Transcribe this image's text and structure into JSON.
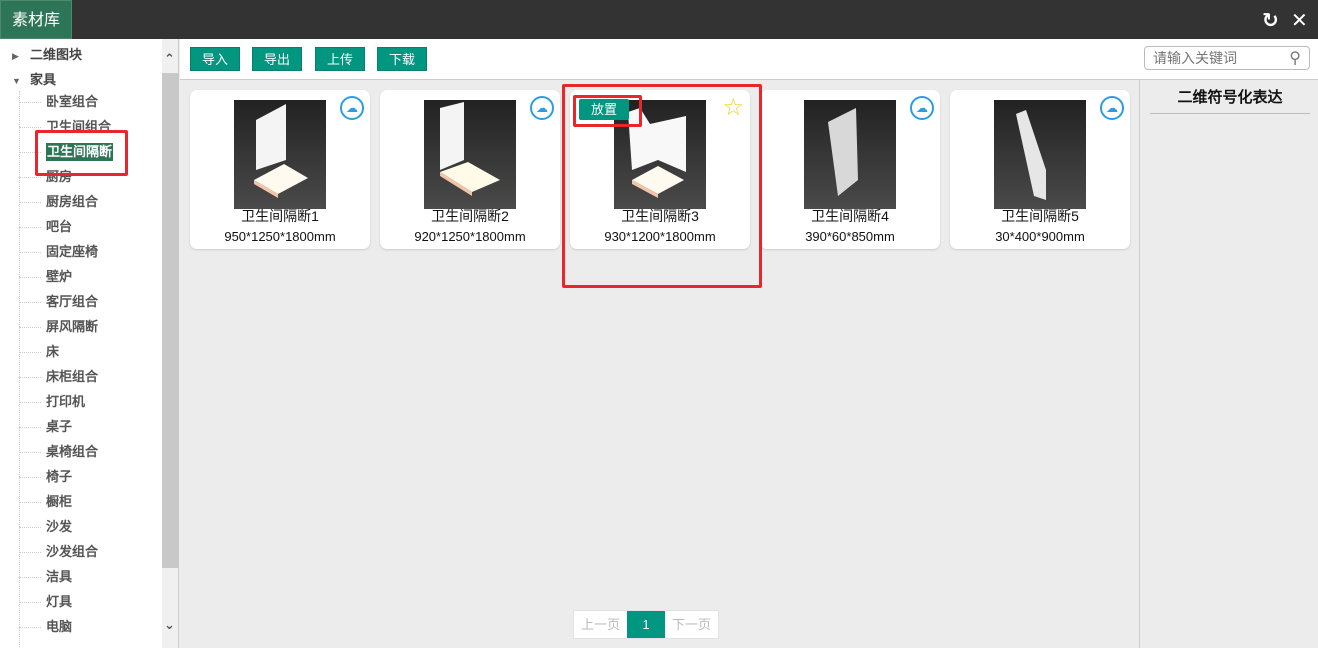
{
  "header": {
    "tab": "素材库",
    "refresh_icon": "refresh-icon",
    "close_icon": "close-icon"
  },
  "sidebar": {
    "roots": [
      {
        "label": "二维图块",
        "expanded": false
      },
      {
        "label": "家具",
        "expanded": true
      }
    ],
    "items": [
      "卧室组合",
      "卫生间组合",
      "卫生间隔断",
      "厨房",
      "厨房组合",
      "吧台",
      "固定座椅",
      "壁炉",
      "客厅组合",
      "屏风隔断",
      "床",
      "床柜组合",
      "打印机",
      "桌子",
      "桌椅组合",
      "椅子",
      "橱柜",
      "沙发",
      "沙发组合",
      "洁具",
      "灯具",
      "电脑"
    ],
    "selected": "卫生间隔断"
  },
  "toolbar": {
    "import": "导入",
    "export": "导出",
    "upload": "上传",
    "download": "下载",
    "search_placeholder": "请输入关键词"
  },
  "right_panel": {
    "title": "二维符号化表达"
  },
  "cards": [
    {
      "name": "卫生间隔断1",
      "size": "950*1250*1800mm"
    },
    {
      "name": "卫生间隔断2",
      "size": "920*1250*1800mm"
    },
    {
      "name": "卫生间隔断3",
      "size": "930*1200*1800mm",
      "place": "放置",
      "hover": true
    },
    {
      "name": "卫生间隔断4",
      "size": "390*60*850mm"
    },
    {
      "name": "卫生间隔断5",
      "size": "30*400*900mm"
    }
  ],
  "pagination": {
    "prev": "上一页",
    "current": "1",
    "next": "下一页"
  }
}
